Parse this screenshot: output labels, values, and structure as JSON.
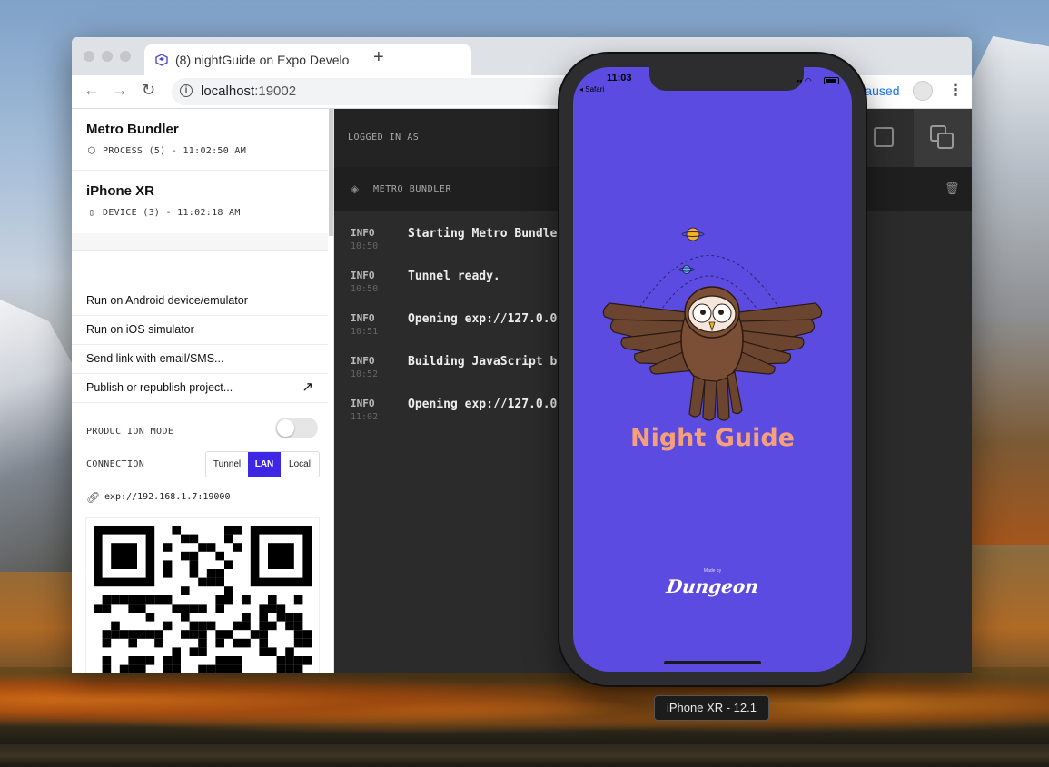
{
  "browser": {
    "tab_title": "(8) nightGuide on Expo Develo",
    "url_host": "localhost",
    "url_port": ":19002",
    "paused_label": "Paused",
    "new_tab_symbol": "+",
    "icons": [
      "back-arrow-icon",
      "forward-arrow-icon",
      "reload-icon",
      "info-icon",
      "avatar-icon",
      "kebab-menu-icon"
    ]
  },
  "sidebar": {
    "bundler": {
      "title": "Metro Bundler",
      "status": "PROCESS (5) - 11:02:50 AM"
    },
    "device": {
      "title": "iPhone XR",
      "status": "DEVICE (3) - 11:02:18 AM"
    },
    "actions": [
      {
        "label": "Run on Android device/emulator"
      },
      {
        "label": "Run on iOS simulator"
      },
      {
        "label": "Send link with email/SMS..."
      },
      {
        "label": "Publish or republish project...",
        "arrow": "↗"
      }
    ],
    "production_mode_label": "PRODUCTION MODE",
    "production_mode_on": false,
    "connection_label": "CONNECTION",
    "connection_options": [
      "Tunnel",
      "LAN",
      "Local"
    ],
    "connection_selected": "LAN",
    "exp_url": "exp://192.168.1.7:19000"
  },
  "logs": {
    "logged_in_label": "LOGGED IN AS",
    "panel_title": "METRO BUNDLER",
    "entries": [
      {
        "level": "INFO",
        "time": "10:50",
        "message": "Starting Metro Bundle"
      },
      {
        "level": "INFO",
        "time": "10:50",
        "message": "Tunnel ready."
      },
      {
        "level": "INFO",
        "time": "10:51",
        "message": "Opening exp://127.0.0."
      },
      {
        "level": "INFO",
        "time": "10:52",
        "message": "Building JavaScript bu"
      },
      {
        "level": "INFO",
        "time": "11:02",
        "message": "Opening exp://127.0.0."
      }
    ]
  },
  "phone": {
    "status_time": "11:03",
    "status_back": "◂ Safari",
    "app_title": "Night Guide",
    "made_by": "Made by",
    "studio": "Dungeon",
    "simulator_label": "iPhone XR - 12.1",
    "colors": {
      "screen_bg": "#5b4be0",
      "title": "#f5a07a"
    }
  },
  "colors": {
    "accent": "#3d26e4",
    "log_bg": "#2b2b2b"
  }
}
